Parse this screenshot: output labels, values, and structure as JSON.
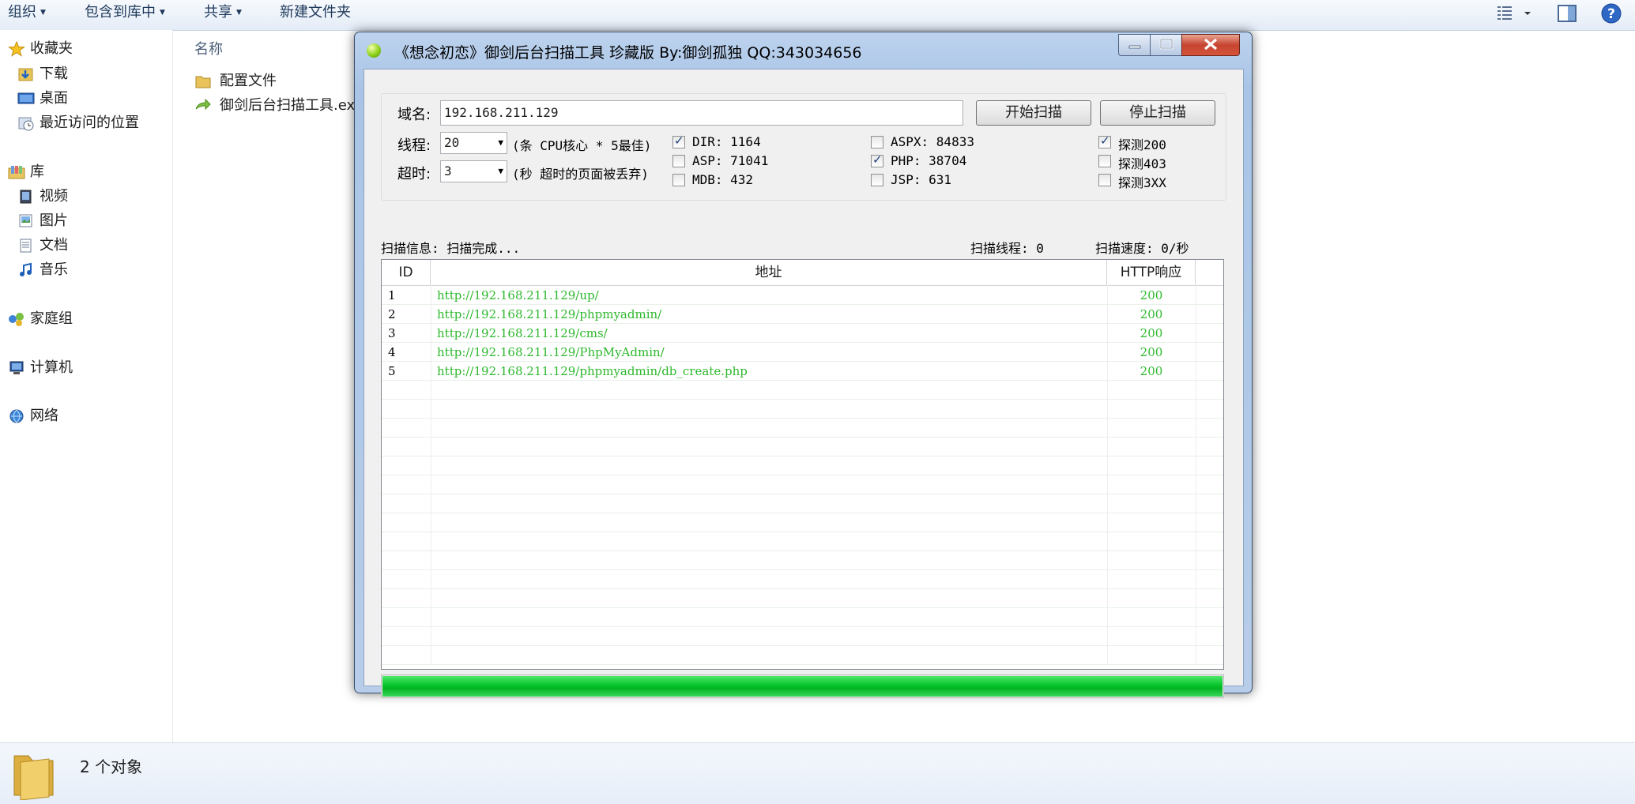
{
  "toolbar": {
    "organize": "组织",
    "include_library": "包含到库中",
    "share": "共享",
    "new_folder": "新建文件夹"
  },
  "nav": {
    "favorites": "收藏夹",
    "downloads": "下载",
    "desktop": "桌面",
    "recent": "最近访问的位置",
    "libraries": "库",
    "videos": "视频",
    "pictures": "图片",
    "documents": "文档",
    "music": "音乐",
    "homegroup": "家庭组",
    "computer": "计算机",
    "network": "网络"
  },
  "filelist": {
    "column_name": "名称",
    "items": [
      "配置文件",
      "御剑后台扫描工具.exe"
    ]
  },
  "status": {
    "count": "2 个对象"
  },
  "app": {
    "title": "《想念初恋》御剑后台扫描工具 珍藏版 By:御剑孤独 QQ:343034656",
    "domain_label": "域名:",
    "domain_value": "192.168.211.129",
    "start_button": "开始扫描",
    "stop_button": "停止扫描",
    "threads_label": "线程:",
    "threads_value": "20",
    "threads_hint": "(条 CPU核心 * 5最佳)",
    "timeout_label": "超时:",
    "timeout_value": "3",
    "timeout_hint": "(秒 超时的页面被丢弃)",
    "options": [
      {
        "label": "DIR: 1164",
        "checked": true
      },
      {
        "label": "ASP: 71041",
        "checked": false
      },
      {
        "label": "MDB: 432",
        "checked": false
      },
      {
        "label": "ASPX: 84833",
        "checked": false
      },
      {
        "label": "PHP: 38704",
        "checked": true
      },
      {
        "label": "JSP: 631",
        "checked": false
      },
      {
        "label": "探测200",
        "checked": true
      },
      {
        "label": "探测403",
        "checked": false
      },
      {
        "label": "探测3XX",
        "checked": false
      }
    ],
    "scan_info_label": "扫描信息:",
    "scan_info_value": "扫描完成...",
    "scan_threads": "扫描线程: 0",
    "scan_speed": "扫描速度: 0/秒",
    "columns": [
      "ID",
      "地址",
      "HTTP响应"
    ],
    "results": [
      {
        "id": "1",
        "url": "http://192.168.211.129/up/",
        "code": "200"
      },
      {
        "id": "2",
        "url": "http://192.168.211.129/phpmyadmin/",
        "code": "200"
      },
      {
        "id": "3",
        "url": "http://192.168.211.129/cms/",
        "code": "200"
      },
      {
        "id": "4",
        "url": "http://192.168.211.129/PhpMyAdmin/",
        "code": "200"
      },
      {
        "id": "5",
        "url": "http://192.168.211.129/phpmyadmin/db_create.php",
        "code": "200"
      }
    ],
    "progress": 1.0,
    "result_color": "#2db82d",
    "progress_color": "#06c42b"
  }
}
